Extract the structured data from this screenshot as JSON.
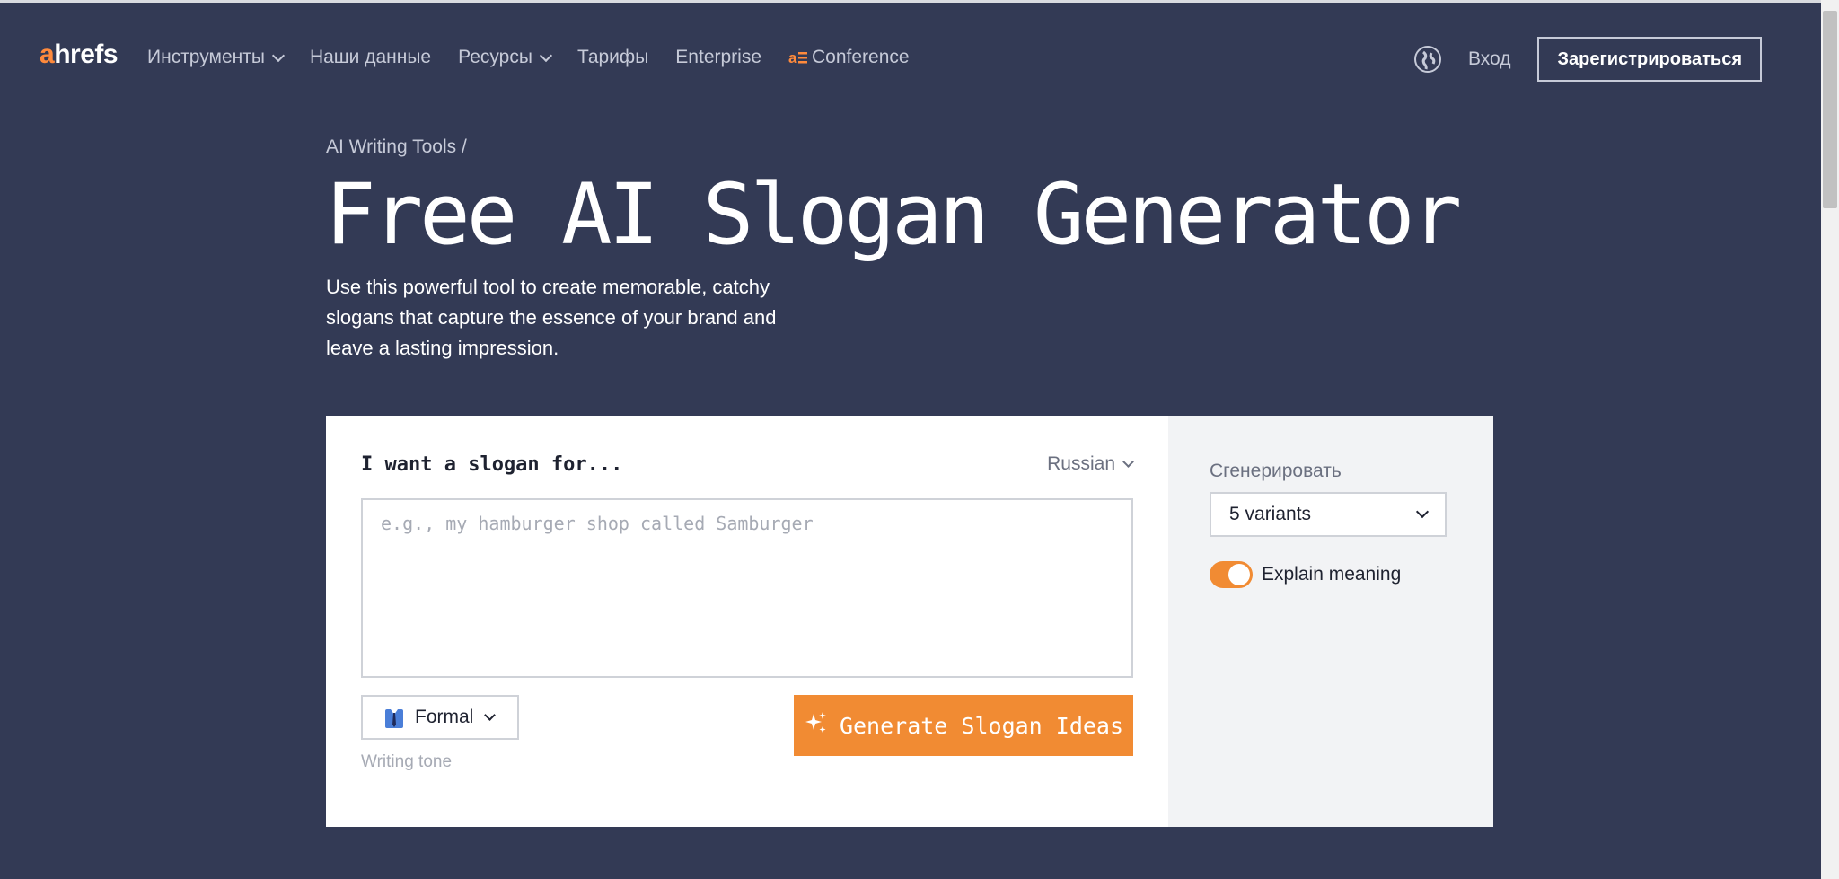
{
  "nav": {
    "logo_a": "a",
    "logo_rest": "hrefs",
    "items": [
      {
        "label": "Инструменты",
        "dropdown": true
      },
      {
        "label": "Наши данные",
        "dropdown": false
      },
      {
        "label": "Ресурсы",
        "dropdown": true
      },
      {
        "label": "Тарифы",
        "dropdown": false
      },
      {
        "label": "Enterprise",
        "dropdown": false
      },
      {
        "label": "Conference",
        "dropdown": false
      }
    ],
    "login_label": "Вход",
    "signup_label": "Зарегистрироваться"
  },
  "hero": {
    "breadcrumb": "AI Writing Tools /",
    "title": "Free AI Slogan Generator",
    "description": "Use this powerful tool to create memorable, catchy slogans that capture the essence of your brand and leave a lasting impression."
  },
  "tool": {
    "prompt_label": "I want a slogan for...",
    "language": "Russian",
    "input_placeholder": "e.g., my hamburger shop called Samburger",
    "input_value": "",
    "tone_value": "Formal",
    "tone_caption": "Writing tone",
    "generate_label": "Generate Slogan Ideas",
    "side": {
      "generate_count_label": "Сгенерировать",
      "variants_value": "5 variants",
      "explain_label": "Explain meaning",
      "explain_enabled": true
    }
  },
  "colors": {
    "background": "#333a55",
    "accent": "#f18b33",
    "logo_accent": "#ff8a3c"
  }
}
